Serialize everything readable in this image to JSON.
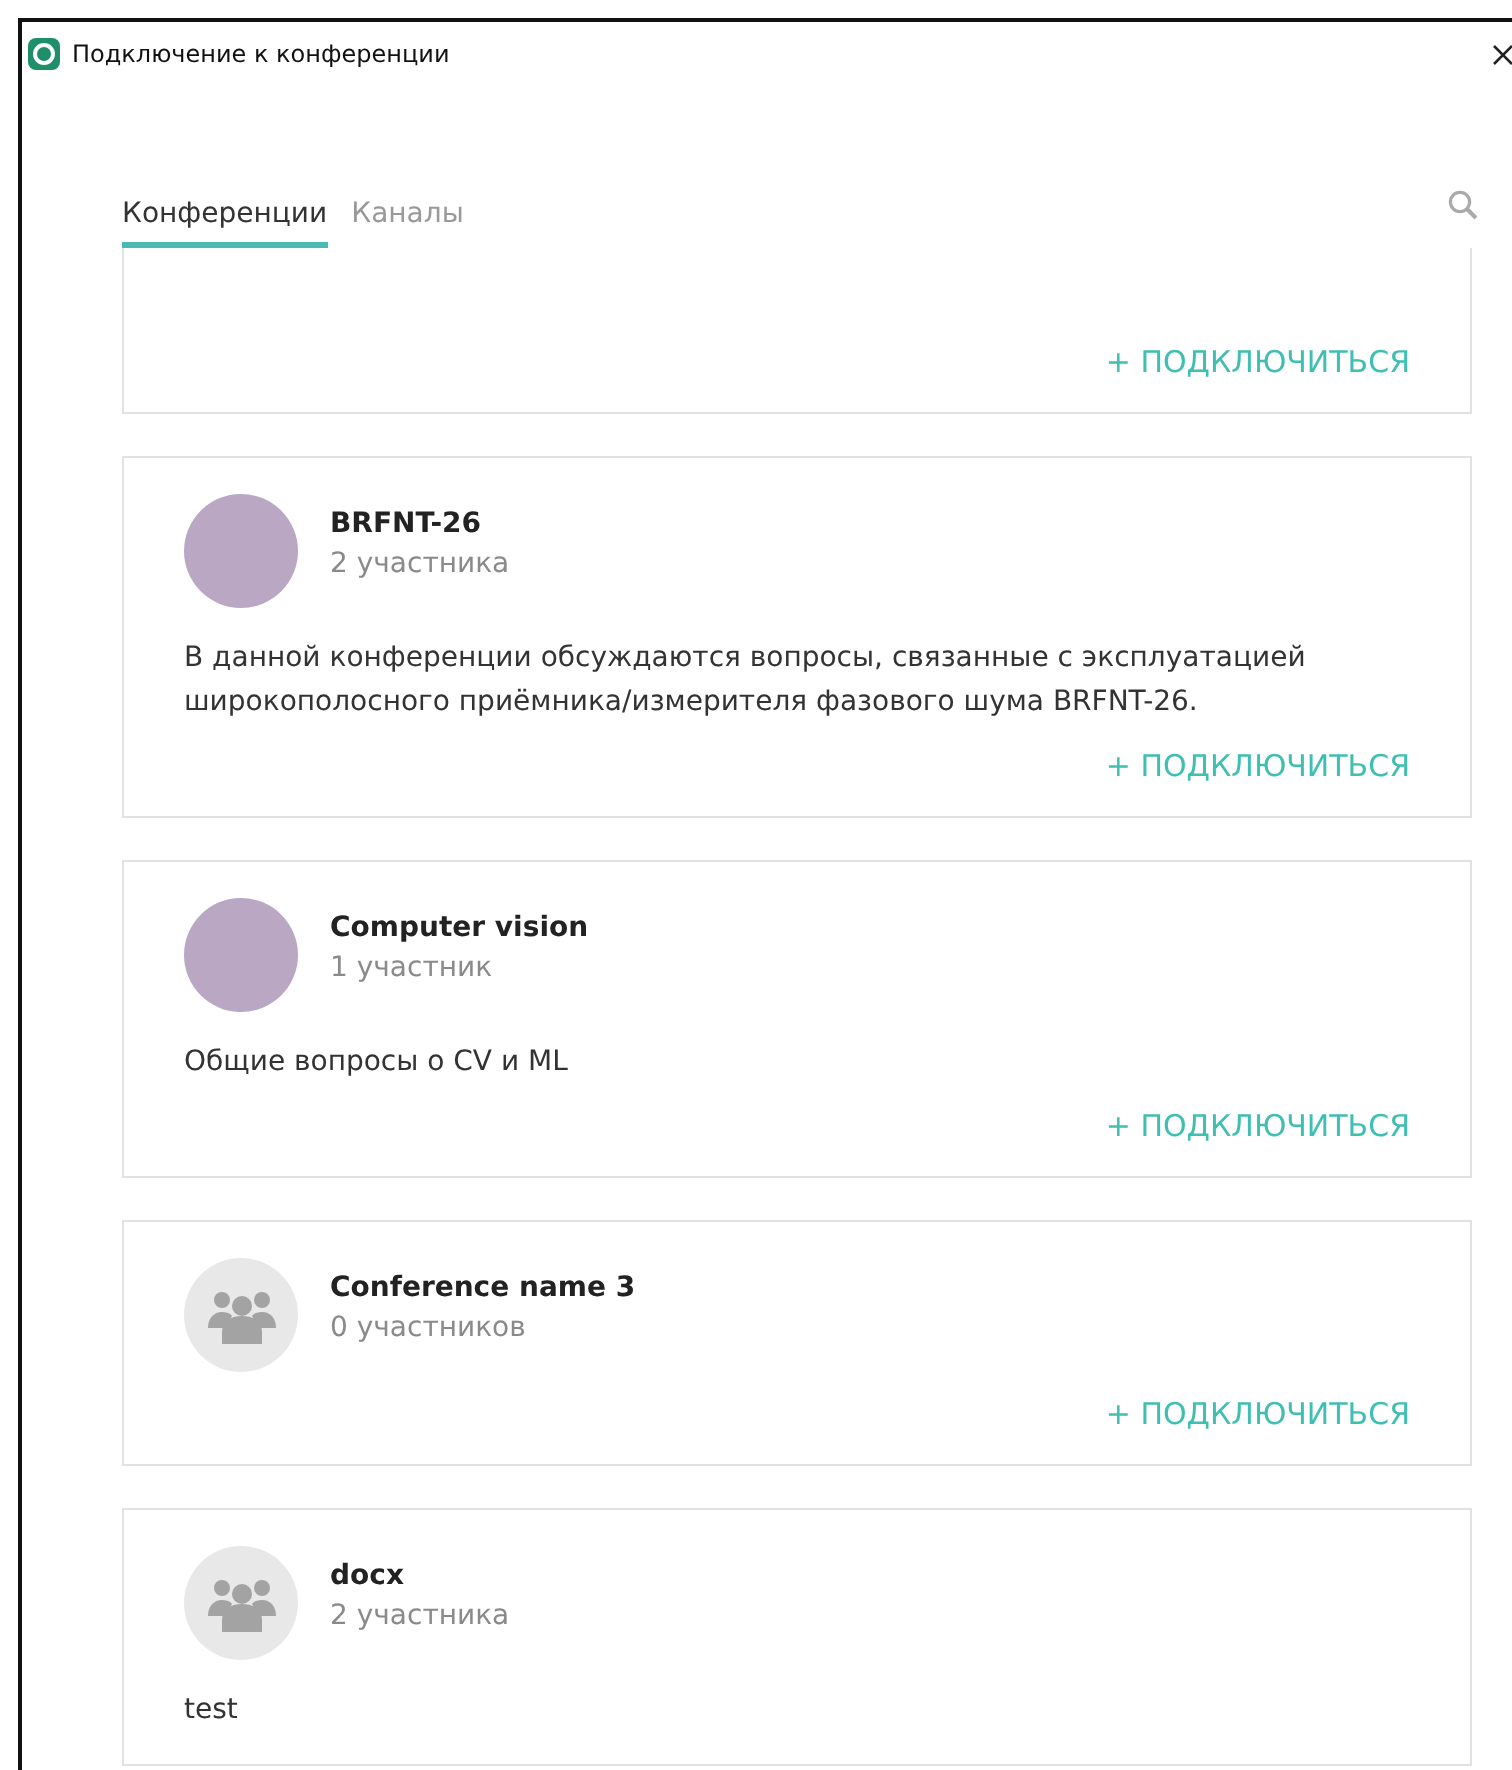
{
  "window": {
    "title": "Подключение к конференции"
  },
  "tabs": [
    {
      "label": "Конференции",
      "selected": true
    },
    {
      "label": "Каналы",
      "selected": false
    }
  ],
  "conferences": [
    {
      "kind": "partial",
      "join": "+ ПОДКЛЮЧИТЬСЯ"
    },
    {
      "kind": "photo",
      "name": "BRFNT-26",
      "members": "2 участника",
      "description": "В данной конференции обсуждаются вопросы, связанные с эксплуатацией широкополосного приёмника/измерителя фазового шума BRFNT-26.",
      "join": "+ ПОДКЛЮЧИТЬСЯ"
    },
    {
      "kind": "photo",
      "name": "Computer vision",
      "members": "1 участник",
      "description": "Общие вопросы о CV и ML",
      "join": "+ ПОДКЛЮЧИТЬСЯ"
    },
    {
      "kind": "group",
      "name": "Conference name 3",
      "members": "0 участников",
      "join": "+ ПОДКЛЮЧИТЬСЯ"
    },
    {
      "kind": "group",
      "name": "docx",
      "members": "2 участника",
      "description": "test"
    }
  ]
}
